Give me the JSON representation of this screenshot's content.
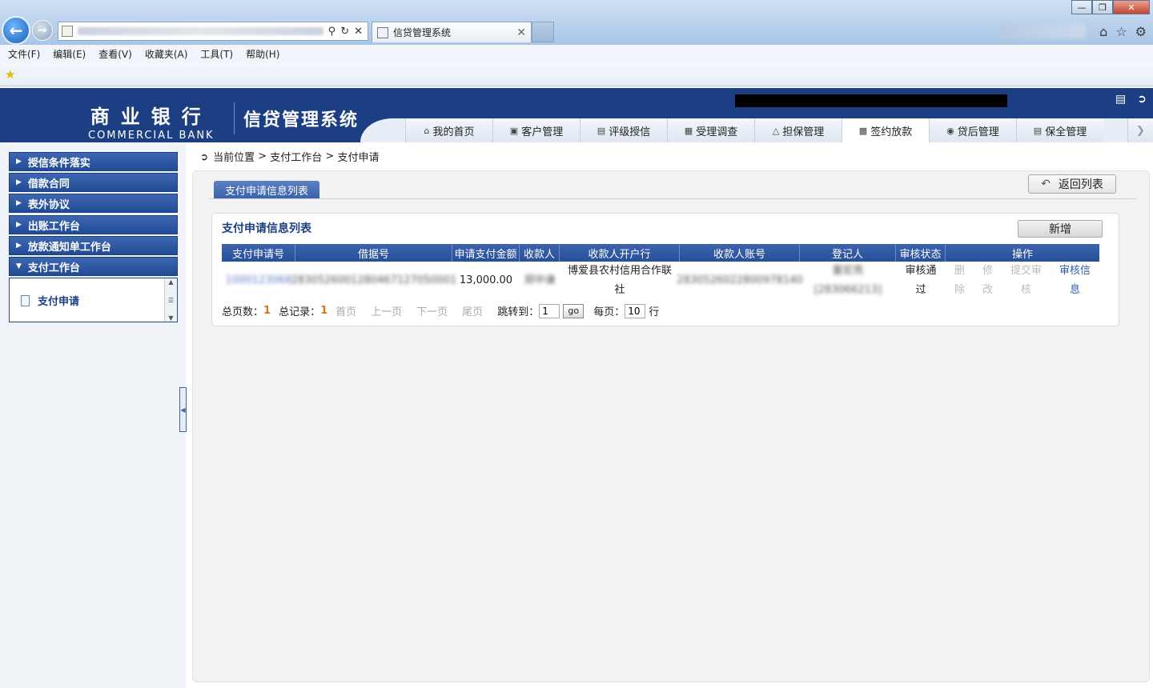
{
  "browser": {
    "tab_title": "信贷管理系统",
    "menu": [
      "文件(F)",
      "编辑(E)",
      "查看(V)",
      "收藏夹(A)",
      "工具(T)",
      "帮助(H)"
    ]
  },
  "header": {
    "brand_cn": "商业银行",
    "brand_en": "COMMERCIAL BANK",
    "system_title": "信贷管理系统"
  },
  "nav": {
    "tabs": [
      {
        "label": "我的首页",
        "icon": "home-icon"
      },
      {
        "label": "客户管理",
        "icon": "customer-icon"
      },
      {
        "label": "评级授信",
        "icon": "rating-icon"
      },
      {
        "label": "受理调查",
        "icon": "survey-icon"
      },
      {
        "label": "担保管理",
        "icon": "guarantee-icon"
      },
      {
        "label": "签约放款",
        "icon": "contract-icon",
        "active": true
      },
      {
        "label": "贷后管理",
        "icon": "postloan-icon"
      },
      {
        "label": "保全管理",
        "icon": "preservation-icon"
      }
    ]
  },
  "sidebar": {
    "items": [
      {
        "label": "授信条件落实"
      },
      {
        "label": "借款合同"
      },
      {
        "label": "表外协议"
      },
      {
        "label": "出账工作台"
      },
      {
        "label": "放款通知单工作台"
      },
      {
        "label": "支付工作台",
        "expanded": true
      }
    ],
    "sub_items": [
      {
        "label": "支付申请"
      }
    ]
  },
  "breadcrumb": {
    "current": "当前位置",
    "sep": ">",
    "level1": "支付工作台",
    "level2": "支付申请"
  },
  "main": {
    "tab_label": "支付申请信息列表",
    "back_button": "返回列表",
    "list_title": "支付申请信息列表",
    "add_button": "新增"
  },
  "grid": {
    "columns": [
      "支付申请号",
      "借据号",
      "申请支付金额",
      "收款人",
      "收款人开户行",
      "收款人账号",
      "登记人",
      "审核状态",
      "操作"
    ],
    "row": {
      "apply_no": "1000123068",
      "loan_no": "2830526001280467127050001",
      "amount": "13,000.00",
      "payee": "郑中谦",
      "bank_line1": "博爱县农村信用合作联",
      "bank_line2": "社",
      "account": "2830526022800978140",
      "registrar_line1": "董宏亮",
      "registrar_line2": "[283066213]",
      "status_line1": "审核通",
      "status_line2": "过",
      "ops": {
        "delete_1": "删",
        "delete_2": "除",
        "modify_1": "修",
        "modify_2": "改",
        "submit_1": "提交审",
        "submit_2": "核",
        "info_1": "审核信",
        "info_2": "息"
      }
    }
  },
  "pager": {
    "total_pages_label": "总页数：",
    "total_pages": "1",
    "total_records_label": "总记录：",
    "total_records": "1",
    "first": "首页",
    "prev": "上一页",
    "next": "下一页",
    "last": "尾页",
    "jump_label": "跳转到：",
    "jump_value": "1",
    "go": "go",
    "per_page_label": "每页：",
    "per_page_value": "10",
    "per_page_unit": "行"
  },
  "colors": {
    "brand_blue": "#1c3f84",
    "grid_header": "#27509a",
    "highlight_orange": "#d9760f"
  }
}
